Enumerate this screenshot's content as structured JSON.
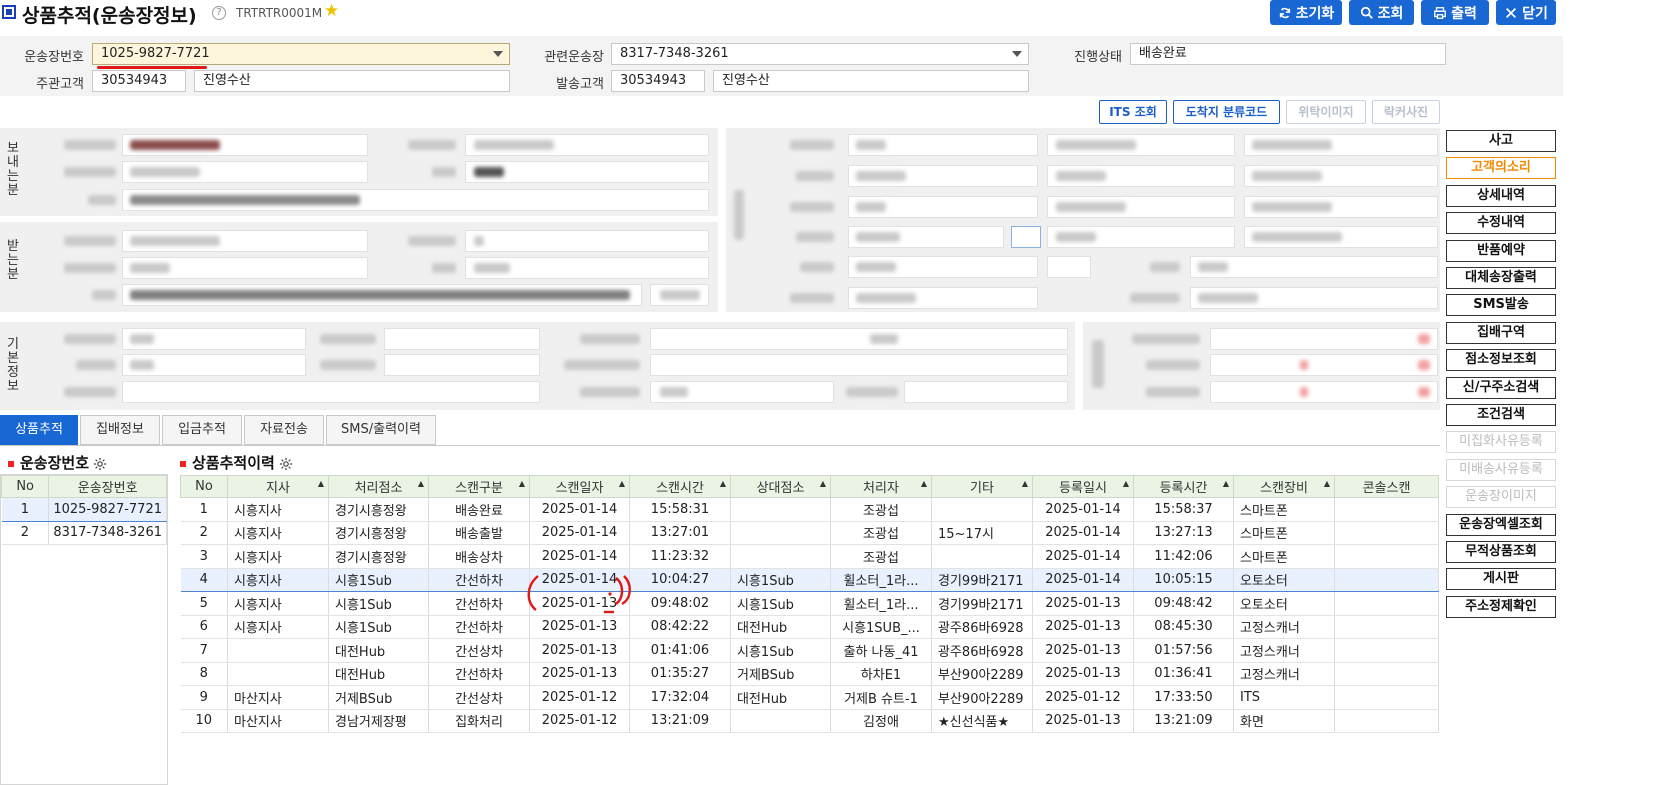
{
  "header": {
    "title": "상품추적(운송장정보)",
    "screen_code": "TRTRTR0001M",
    "help": "?"
  },
  "toolbar": {
    "reset": "초기화",
    "search": "조회",
    "print": "출력",
    "close": "닫기"
  },
  "search": {
    "waybill_label": "운송장번호",
    "waybill_value": "1025-9827-7721",
    "related_label": "관련운송장",
    "related_value": "8317-7348-3261",
    "status_label": "진행상태",
    "status_value": "배송완료",
    "main_customer_label": "주관고객",
    "main_customer_code": "30534943",
    "main_customer_name": "진영수산",
    "ship_customer_label": "발송고객",
    "ship_customer_code": "30534943",
    "ship_customer_name": "진영수산"
  },
  "subbuttons": {
    "its": "ITS 조회",
    "dest_code": "도착지 분류코드",
    "consign_image": "위탁이미지",
    "locker_photo": "락커사진"
  },
  "sections": {
    "sender": "보내는분",
    "receiver": "받는분",
    "basic": "기본정보"
  },
  "side_buttons": [
    "사고",
    "고객의소리",
    "상세내역",
    "수정내역",
    "반품예약",
    "대체송장출력",
    "SMS발송",
    "집배구역",
    "점소정보조회",
    "신/구주소검색",
    "조건검색",
    "미집화사유등록",
    "미배송사유등록",
    "운송장이미지",
    "운송장엑셀조회",
    "무적상품조회",
    "게시판",
    "주소정제확인"
  ],
  "tabs": [
    "상품추적",
    "집배정보",
    "입금추적",
    "자료전송",
    "SMS/출력이력"
  ],
  "waybill_panel": {
    "title": "운송장번호",
    "headers": [
      "No",
      "운송장번호"
    ],
    "rows": [
      [
        "1",
        "1025-9827-7721"
      ],
      [
        "2",
        "8317-7348-3261"
      ]
    ]
  },
  "history": {
    "title": "상품추적이력",
    "headers": [
      "No",
      "지사",
      "처리점소",
      "스캔구분",
      "스캔일자",
      "스캔시간",
      "상대점소",
      "처리자",
      "기타",
      "등록일시",
      "등록시간",
      "스캔장비",
      "콘솔스캔"
    ],
    "rows": [
      [
        "1",
        "시흥지사",
        "경기시흥정왕",
        "배송완료",
        "2025-01-14",
        "15:58:31",
        "",
        "조광섭",
        "",
        "2025-01-14",
        "15:58:37",
        "스마트폰",
        ""
      ],
      [
        "2",
        "시흥지사",
        "경기시흥정왕",
        "배송출발",
        "2025-01-14",
        "13:27:01",
        "",
        "조광섭",
        "15~17시",
        "2025-01-14",
        "13:27:13",
        "스마트폰",
        ""
      ],
      [
        "3",
        "시흥지사",
        "경기시흥정왕",
        "배송상차",
        "2025-01-14",
        "11:23:32",
        "",
        "조광섭",
        "",
        "2025-01-14",
        "11:42:06",
        "스마트폰",
        ""
      ],
      [
        "4",
        "시흥지사",
        "시흥1Sub",
        "간선하차",
        "2025-01-14",
        "10:04:27",
        "시흥1Sub",
        "휠소터_1라...",
        "경기99바2171",
        "2025-01-14",
        "10:05:15",
        "오토소터",
        ""
      ],
      [
        "5",
        "시흥지사",
        "시흥1Sub",
        "간선하차",
        "2025-01-13",
        "09:48:02",
        "시흥1Sub",
        "휠소터_1라...",
        "경기99바2171",
        "2025-01-13",
        "09:48:42",
        "오토소터",
        ""
      ],
      [
        "6",
        "시흥지사",
        "시흥1Sub",
        "간선하차",
        "2025-01-13",
        "08:42:22",
        "대전Hub",
        "시흥1SUB_...",
        "광주86바6928",
        "2025-01-13",
        "08:45:30",
        "고정스캐너",
        ""
      ],
      [
        "7",
        "",
        "대전Hub",
        "간선상차",
        "2025-01-13",
        "01:41:06",
        "시흥1Sub",
        "출하 나동_41",
        "광주86바6928",
        "2025-01-13",
        "01:57:56",
        "고정스캐너",
        ""
      ],
      [
        "8",
        "",
        "대전Hub",
        "간선하차",
        "2025-01-13",
        "01:35:27",
        "거제BSub",
        "하차E1",
        "부산90아2289",
        "2025-01-13",
        "01:36:41",
        "고정스캐너",
        ""
      ],
      [
        "9",
        "마산지사",
        "거제BSub",
        "간선상차",
        "2025-01-12",
        "17:32:04",
        "대전Hub",
        "거제B 슈트-1",
        "부산90아2289",
        "2025-01-12",
        "17:33:50",
        "ITS",
        ""
      ],
      [
        "10",
        "마산지사",
        "경남거제장평",
        "집화처리",
        "2025-01-12",
        "13:21:09",
        "",
        "김정애",
        "★신선식품★",
        "2025-01-13",
        "13:21:09",
        "화면",
        ""
      ]
    ]
  }
}
